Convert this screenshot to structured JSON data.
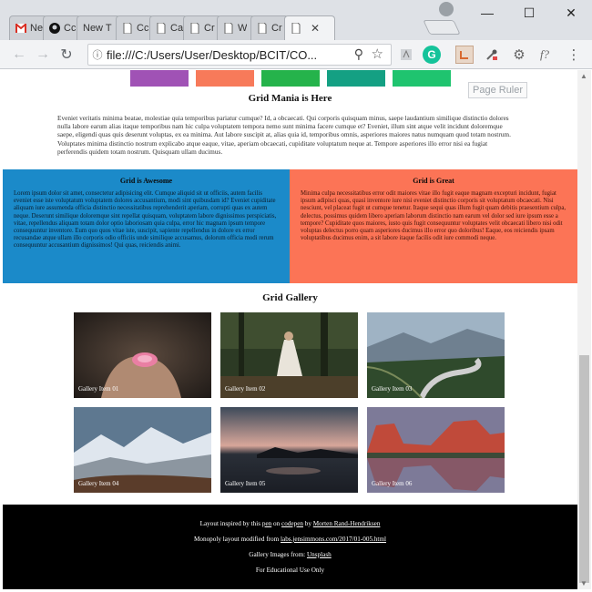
{
  "browser": {
    "tabs": [
      {
        "label": "Ne",
        "icon": "gmail-icon",
        "active": false
      },
      {
        "label": "Cc",
        "icon": "github-icon",
        "active": false
      },
      {
        "label": "New T",
        "icon": "blank",
        "active": false
      },
      {
        "label": "Cc",
        "icon": "page-icon",
        "active": false
      },
      {
        "label": "Ca",
        "icon": "page-icon",
        "active": false
      },
      {
        "label": "Cr",
        "icon": "page-icon",
        "active": false
      },
      {
        "label": "W",
        "icon": "page-icon",
        "active": false
      },
      {
        "label": "Cr",
        "icon": "page-icon",
        "active": false
      },
      {
        "label": "",
        "icon": "page-icon",
        "active": true
      }
    ],
    "url": "file:///C:/Users/User/Desktop/BCIT/CO...",
    "omnibox_info_icon": "info-icon",
    "window_controls": {
      "minimize": "—",
      "maximize": "☐",
      "close": "✕"
    },
    "extensions": [
      "pdf-icon",
      "grammarly-icon",
      "page-ruler-icon",
      "eyedropper-icon",
      "settings-icon",
      "formula-icon",
      "menu-icon"
    ],
    "extension_labels": {
      "grammarly": "G",
      "formula": "f?",
      "menu": "⋮"
    }
  },
  "page": {
    "page_ruler_label": "Page Ruler",
    "swatch_colors": [
      "#a052b5",
      "#f77a5a",
      "#25b34b",
      "#14a083",
      "#1fc46f"
    ],
    "hero": {
      "title": "Grid Mania is Here",
      "text": "Eveniet veritatis minima beatae, molestiae quia temporibus pariatur cumque? Id, a obcaecati. Qui corporis quisquam minus, saepe laudantium similique distinctio dolores nulla labore earum alias itaque temporibus nam hic culpa voluptatem tempora nemo sunt minima facere cumque et? Eveniet, illum sint atque velit incidunt doloremque saepe, eligendi quas quis deserunt voluptas, ex ea minima. Aut labore suscipit at, alias quia id, temporibus omnis, asperiores maiores natus numquam quod totam nostrum. Voluptates minima distinctio nostrum explicabo atque eaque, vitae, aperiam obcaecati, cupiditate voluptatum neque at. Tempore asperiores illo error nisi ea fugiat perferendis quidem totam nostrum. Quisquam ullam ducimus."
    },
    "columns": [
      {
        "title": "Grid is Awesome",
        "color": "#1b8ac9",
        "text": "Lorem ipsum dolor sit amet, consectetur adipisicing elit. Cumque aliquid sit ut officiis, autem facilis eveniet esse iste voluptatum voluptatem dolores accusantium, modi sint quibusdam id? Eveniet cupiditate aliquam iure assumenda officia distinctio necessitatibus reprehenderit aperiam, corrupti quas ex autem neque. Deserunt similique doloremque sint repellat quisquam, voluptatem labore dignissimos perspiciatis, vitae, repellendus aliquam totam dolor optio laboriosam quia culpa, error hic magnam ipsum tempore consequuntur inventore. Eum quo quos vitae iste, suscipit, sapiente repellendus in dolore ex error recusandae atque ullam illo corporis odio officiis unde similique accusamus, dolorum officia modi rerum consequuntur accusantium dignissimos! Qui quas, reiciendis animi."
      },
      {
        "title": "Grid is Great",
        "color": "#fc7456",
        "text": "Minima culpa necessitatibus error odit maiores vitae illo fugit eaque magnam excepturi incidunt, fugiat ipsum adipisci quas, quasi inventore iure nisi eveniet distinctio corporis sit voluptatum obcaecati. Nisi nesciunt, vel placeat fugit ut cumque tenetur. Itaque sequi quas illum fugit quam debitis praesentium culpa, delectus, possimus quidem libero aperiam laborum distinctio nam earum vel dolor sed iure ipsum esse a tempore? Cupiditate quos maiores, iusto quis fugit consequuntur voluptates velit obcaecati libero nisi odit voluptas delectus porro quam asperiores ducimus illo error quo doloribus! Eaque, eos reiciendis ipsam voluptatibus ducimus enim, a sit labore itaque facilis odit iure commodi neque."
      }
    ],
    "gallery": {
      "title": "Grid Gallery",
      "items": [
        {
          "label": "Gallery Item 01",
          "scene": "hands-holding-pink-flower"
        },
        {
          "label": "Gallery Item 02",
          "scene": "woman-in-white-dress-in-forest"
        },
        {
          "label": "Gallery Item 03",
          "scene": "winding-road-through-mountains"
        },
        {
          "label": "Gallery Item 04",
          "scene": "snowy-mountain-range"
        },
        {
          "label": "Gallery Item 05",
          "scene": "lake-at-dusk"
        },
        {
          "label": "Gallery Item 06",
          "scene": "red-cliffs-reflected-in-lake"
        }
      ]
    },
    "footer": {
      "line1_prefix": "Layout inspired by this",
      "line1_link1": "pen",
      "line1_on": "on",
      "line1_link2": "codepen",
      "line1_by": "by",
      "line1_link3": "Morten Rand-Hendriksen",
      "line2_prefix": "Monopoly layout modified from",
      "line2_link": "labs.jensimmons.com/2017/01-005.html",
      "line3_prefix": "Gallery Images from:",
      "line3_link": "Unsplash",
      "line4": "For Educational Use Only"
    }
  }
}
